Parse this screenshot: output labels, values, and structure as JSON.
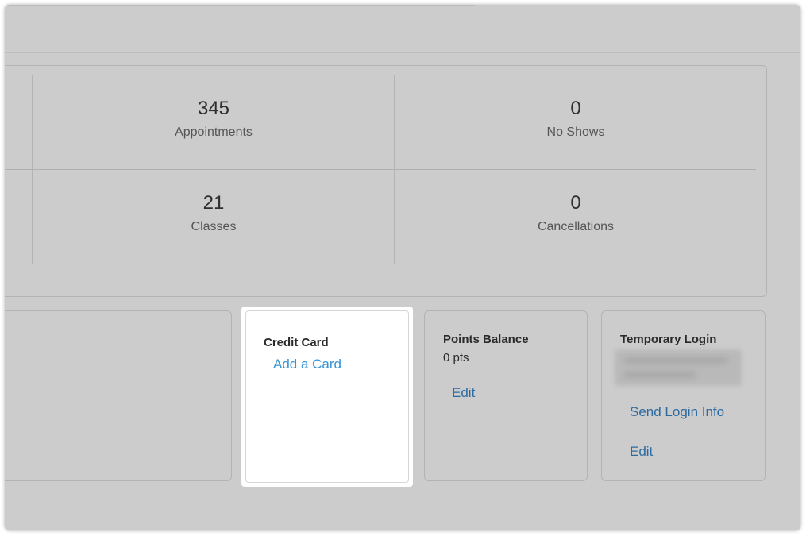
{
  "stats": {
    "appointments": {
      "value": "345",
      "label": "Appointments"
    },
    "no_shows": {
      "value": "0",
      "label": "No Shows"
    },
    "classes": {
      "value": "21",
      "label": "Classes"
    },
    "cancellations": {
      "value": "0",
      "label": "Cancellations"
    }
  },
  "credit_card": {
    "title": "Credit Card",
    "add_label": "Add a Card"
  },
  "points_balance": {
    "title": "Points Balance",
    "value": "0 pts",
    "edit_label": "Edit"
  },
  "temporary_login": {
    "title": "Temporary Login",
    "send_label": "Send Login Info",
    "edit_label": "Edit"
  },
  "colors": {
    "overlay": "#cccccc",
    "highlight": "#ffffff",
    "link": "#2c6aa0",
    "link_highlight": "#3a93d6"
  }
}
